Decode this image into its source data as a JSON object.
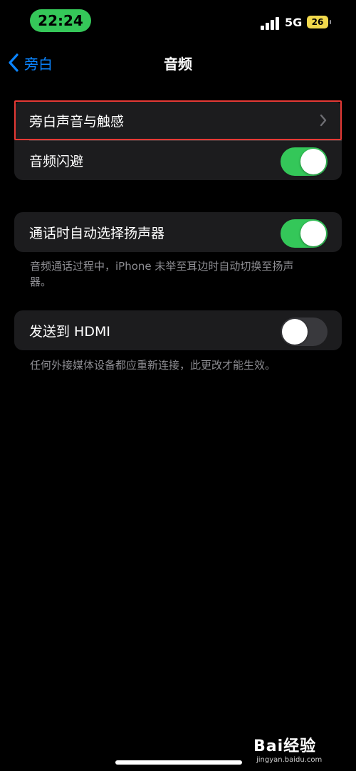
{
  "status_bar": {
    "time": "22:24",
    "network": "5G",
    "battery": "26",
    "colors": {
      "time_pill": "#35c759",
      "battery": "#f1d84c"
    }
  },
  "nav": {
    "back_label": "旁白",
    "title": "音频",
    "accent": "#0a84ff"
  },
  "groups": [
    {
      "rows": [
        {
          "label": "旁白声音与触感",
          "accessory": "chevron-right-icon"
        },
        {
          "label": "音频闪避",
          "toggle": true
        }
      ]
    },
    {
      "rows": [
        {
          "label": "通话时自动选择扬声器",
          "toggle": true
        }
      ],
      "footer": "音频通话过程中，iPhone 未举至耳边时自动切换至扬声器。"
    },
    {
      "rows": [
        {
          "label": "发送到 HDMI",
          "toggle": false
        }
      ],
      "footer": "任何外接媒体设备都应重新连接，此更改才能生效。"
    }
  ],
  "watermark": {
    "logo": "Bai经验",
    "site": "jingyan.baidu.com"
  }
}
